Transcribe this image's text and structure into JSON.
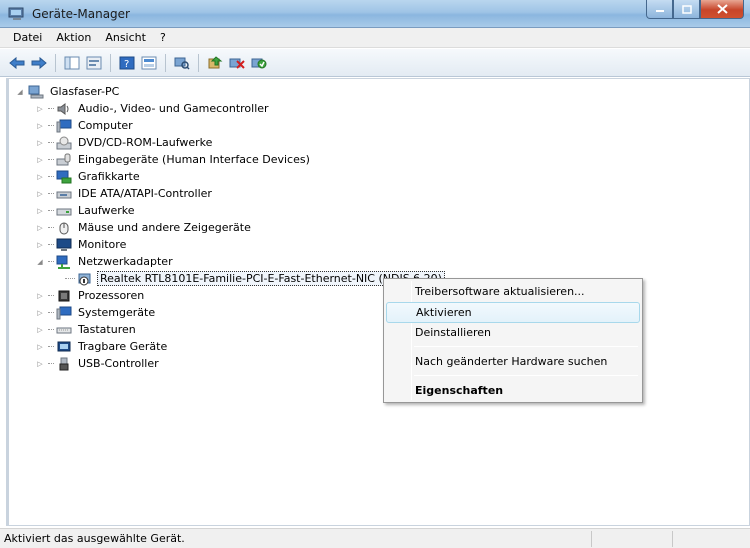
{
  "window": {
    "title": "Geräte-Manager"
  },
  "menu": [
    "Datei",
    "Aktion",
    "Ansicht",
    "?"
  ],
  "toolbar": {
    "icons": [
      "back-arrow-icon",
      "forward-arrow-icon",
      "console-tree-icon",
      "properties-icon",
      "help-icon",
      "view-icon",
      "scan-hardware-icon",
      "update-driver-icon",
      "disable-device-icon",
      "enable-device-icon"
    ]
  },
  "tree": {
    "root": "Glasfaser-PC",
    "items": [
      {
        "label": "Audio-, Video- und Gamecontroller",
        "icon": "speaker-icon"
      },
      {
        "label": "Computer",
        "icon": "computer-icon"
      },
      {
        "label": "DVD/CD-ROM-Laufwerke",
        "icon": "dvd-drive-icon"
      },
      {
        "label": "Eingabegeräte (Human Interface Devices)",
        "icon": "input-device-icon"
      },
      {
        "label": "Grafikkarte",
        "icon": "display-adapter-icon"
      },
      {
        "label": "IDE ATA/ATAPI-Controller",
        "icon": "ide-controller-icon"
      },
      {
        "label": "Laufwerke",
        "icon": "disk-drive-icon"
      },
      {
        "label": "Mäuse und andere Zeigegeräte",
        "icon": "mouse-icon"
      },
      {
        "label": "Monitore",
        "icon": "monitor-icon"
      },
      {
        "label": "Netzwerkadapter",
        "icon": "network-adapter-icon"
      },
      {
        "label": "Realtek RTL8101E-Familie-PCI-E-Fast-Ethernet-NIC (NDIS 6.20)",
        "icon": "network-card-disabled-icon"
      },
      {
        "label": "Prozessoren",
        "icon": "processor-icon"
      },
      {
        "label": "Systemgeräte",
        "icon": "system-device-icon"
      },
      {
        "label": "Tastaturen",
        "icon": "keyboard-icon"
      },
      {
        "label": "Tragbare Geräte",
        "icon": "portable-device-icon"
      },
      {
        "label": "USB-Controller",
        "icon": "usb-icon"
      }
    ]
  },
  "context_menu": {
    "items": [
      "Treibersoftware aktualisieren...",
      "Aktivieren",
      "Deinstallieren",
      "Nach geänderter Hardware suchen",
      "Eigenschaften"
    ]
  },
  "statusbar": {
    "text": "Aktiviert das ausgewählte Gerät."
  },
  "colors": {
    "accent": "#4a7ab0",
    "highlight": "#e3f2fa",
    "titlebar": "#9fc4e6"
  }
}
